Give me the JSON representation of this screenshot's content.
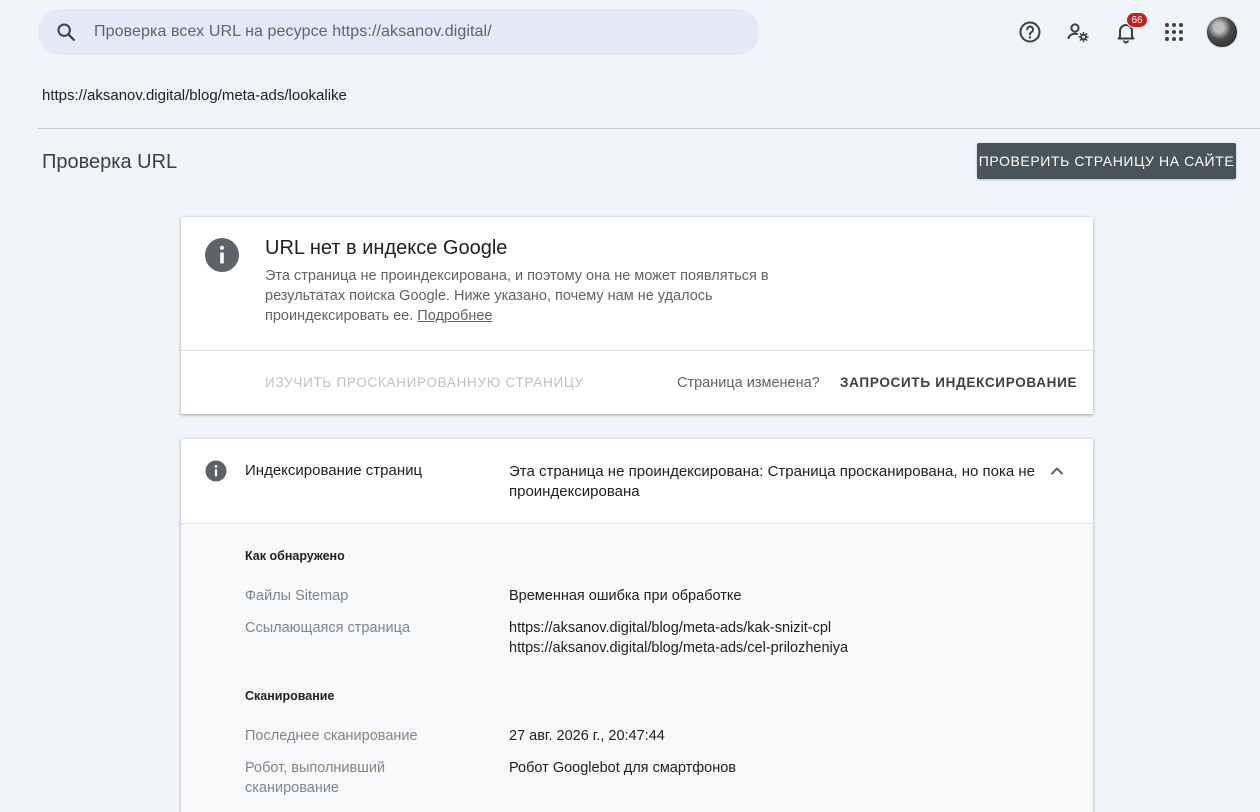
{
  "header": {
    "search_placeholder": "Проверка всех URL на ресурсе https://aksanov.digital/",
    "notifications_count": "66",
    "icons": [
      "search-icon",
      "help-icon",
      "manage-account-icon",
      "notifications-icon",
      "apps-icon",
      "avatar"
    ]
  },
  "inspected_url": "https://aksanov.digital/blog/meta-ads/lookalike",
  "page": {
    "title": "Проверка URL",
    "test_live_button": "ПРОВЕРИТЬ СТРАНИЦУ НА САЙТЕ"
  },
  "status_card": {
    "title": "URL нет в индексе Google",
    "description": "Эта страница не проиндексирована, и поэтому она не может появляться в результатах поиска Google. Ниже указано, почему нам не удалось проиндексировать ее.",
    "learn_more": "Подробнее",
    "view_crawled": "ИЗУЧИТЬ ПРОСКАНИРОВАННУЮ СТРАНИЦУ",
    "page_changed": "Страница изменена?",
    "request_indexing": "ЗАПРОСИТЬ ИНДЕКСИРОВАНИЕ"
  },
  "indexing": {
    "label": "Индексирование страниц",
    "verdict": "Эта страница не проиндексирована: Страница просканирована, но пока не проиндексирована",
    "discovery": {
      "heading": "Как обнаружено",
      "sitemaps_label": "Файлы Sitemap",
      "sitemaps_value": "Временная ошибка при обработке",
      "referring_label": "Ссылающаяся страница",
      "referring_values": [
        "https://aksanov.digital/blog/meta-ads/kak-snizit-cpl",
        "https://aksanov.digital/blog/meta-ads/cel-prilozheniya"
      ]
    },
    "crawl": {
      "heading": "Сканирование",
      "last_crawl_label": "Последнее сканирование",
      "last_crawl_value": "27 авг. 2026 г., 20:47:44",
      "crawled_as_label": "Робот, выполнивший сканирование",
      "crawled_as_value": "Робот Googlebot для смартфонов"
    }
  },
  "colors": {
    "page_bg": "#f1f4f9",
    "search_bg": "#e3eaf6",
    "primary_button": "#47545c",
    "badge": "#c5221f"
  }
}
